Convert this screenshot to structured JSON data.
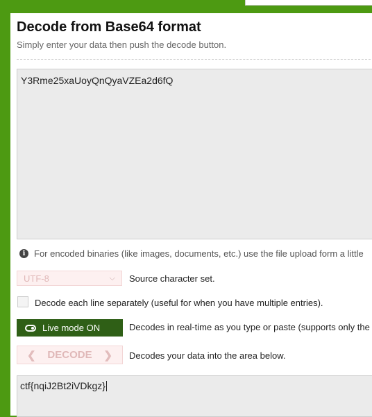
{
  "header": {
    "title": "Decode from Base64 format",
    "subtitle": "Simply enter your data then push the decode button."
  },
  "input": {
    "value": "Y3Rme25xaUoyQnQyaVZEa2d6fQ"
  },
  "info": {
    "icon": "info-icon",
    "text": "For encoded binaries (like images, documents, etc.) use the file upload form a little"
  },
  "charset": {
    "selected": "UTF-8",
    "label": "Source character set."
  },
  "each_line": {
    "checked": false,
    "label": "Decode each line separately (useful for when you have multiple entries)."
  },
  "live_mode": {
    "button_label": "Live mode ON",
    "description": "Decodes in real-time as you type or paste (supports only the"
  },
  "decode": {
    "button_label": "DECODE",
    "description": "Decodes your data into the area below."
  },
  "output": {
    "value": "ctf{nqiJ2Bt2iVDkgz}"
  },
  "colors": {
    "background_green": "#4d9a12",
    "live_button": "#2f5f16"
  }
}
